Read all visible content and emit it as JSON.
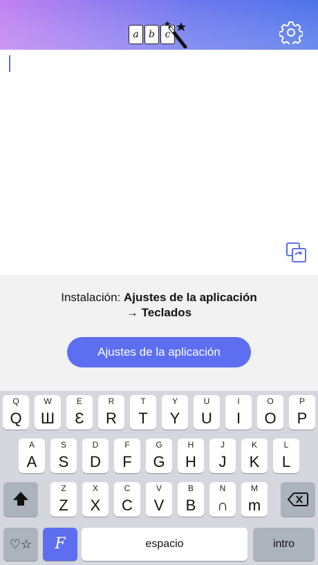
{
  "header": {
    "logo_letters": [
      "a",
      "b",
      "c"
    ]
  },
  "info": {
    "prefix": "Instalación: ",
    "line1_bold": "Ajustes de la aplicación",
    "line2_bold": "→ Teclados"
  },
  "button": {
    "label": "Ajustes de la aplicación"
  },
  "keyboard": {
    "row1": [
      {
        "small": "Q",
        "large": "Q"
      },
      {
        "small": "W",
        "large": "Ш"
      },
      {
        "small": "E",
        "large": "Ɛ"
      },
      {
        "small": "R",
        "large": "R"
      },
      {
        "small": "T",
        "large": "T"
      },
      {
        "small": "Y",
        "large": "Y"
      },
      {
        "small": "U",
        "large": "U"
      },
      {
        "small": "I",
        "large": "I"
      },
      {
        "small": "O",
        "large": "O"
      },
      {
        "small": "P",
        "large": "P"
      }
    ],
    "row2": [
      {
        "small": "A",
        "large": "A"
      },
      {
        "small": "S",
        "large": "S"
      },
      {
        "small": "D",
        "large": "D"
      },
      {
        "small": "F",
        "large": "F"
      },
      {
        "small": "G",
        "large": "G"
      },
      {
        "small": "H",
        "large": "H"
      },
      {
        "small": "J",
        "large": "J"
      },
      {
        "small": "K",
        "large": "K"
      },
      {
        "small": "L",
        "large": "L"
      }
    ],
    "row3": [
      {
        "small": "Z",
        "large": "Z"
      },
      {
        "small": "X",
        "large": "X"
      },
      {
        "small": "C",
        "large": "C"
      },
      {
        "small": "V",
        "large": "V"
      },
      {
        "small": "B",
        "large": "B"
      },
      {
        "small": "N",
        "large": "∩"
      },
      {
        "small": "M",
        "large": "m"
      }
    ],
    "emoji_key": "♡☆",
    "fonts_key": "F",
    "space_label": "espacio",
    "return_label": "intro"
  },
  "colors": {
    "accent": "#5d6ef0",
    "keyboard_bg": "#d4d7dd"
  }
}
